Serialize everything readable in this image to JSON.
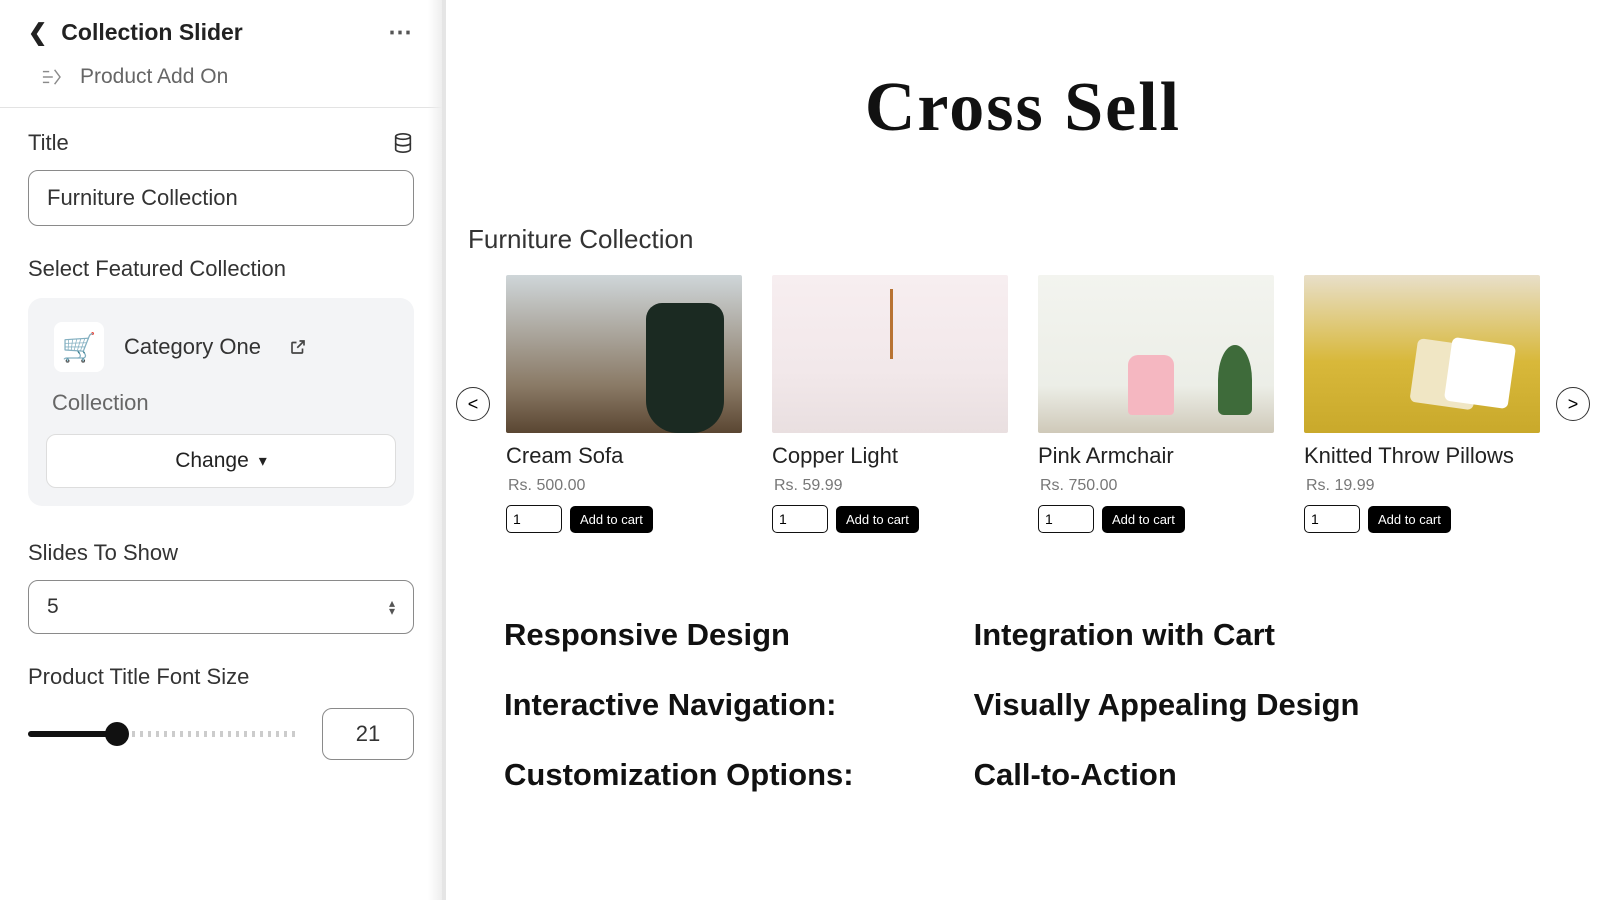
{
  "sidebar": {
    "title": "Collection Slider",
    "addon_label": "Product Add On",
    "title_field_label": "Title",
    "title_value": "Furniture Collection",
    "featured_label": "Select Featured Collection",
    "collection_name": "Category One",
    "collection_sublabel": "Collection",
    "change_label": "Change",
    "slides_label": "Slides To Show",
    "slides_value": "5",
    "fontsize_label": "Product Title Font Size",
    "fontsize_value": "21"
  },
  "preview": {
    "hero": "Cross Sell",
    "collection_heading": "Furniture Collection",
    "nav_prev": "<",
    "nav_next": ">",
    "default_qty": "1",
    "addcart_label": "Add to cart",
    "products": [
      {
        "title": "Cream Sofa",
        "price": "Rs. 500.00",
        "img_class": "img-sofa"
      },
      {
        "title": "Copper Light",
        "price": "Rs. 59.99",
        "img_class": "img-copper"
      },
      {
        "title": "Pink Armchair",
        "price": "Rs. 750.00",
        "img_class": "img-pink"
      },
      {
        "title": "Knitted Throw Pillows",
        "price": "Rs. 19.99",
        "img_class": "img-pillow"
      }
    ],
    "features_left": [
      "Responsive Design",
      "Interactive Navigation:",
      "Customization Options:"
    ],
    "features_right": [
      "Integration with Cart",
      "Visually Appealing Design",
      "Call-to-Action"
    ]
  }
}
